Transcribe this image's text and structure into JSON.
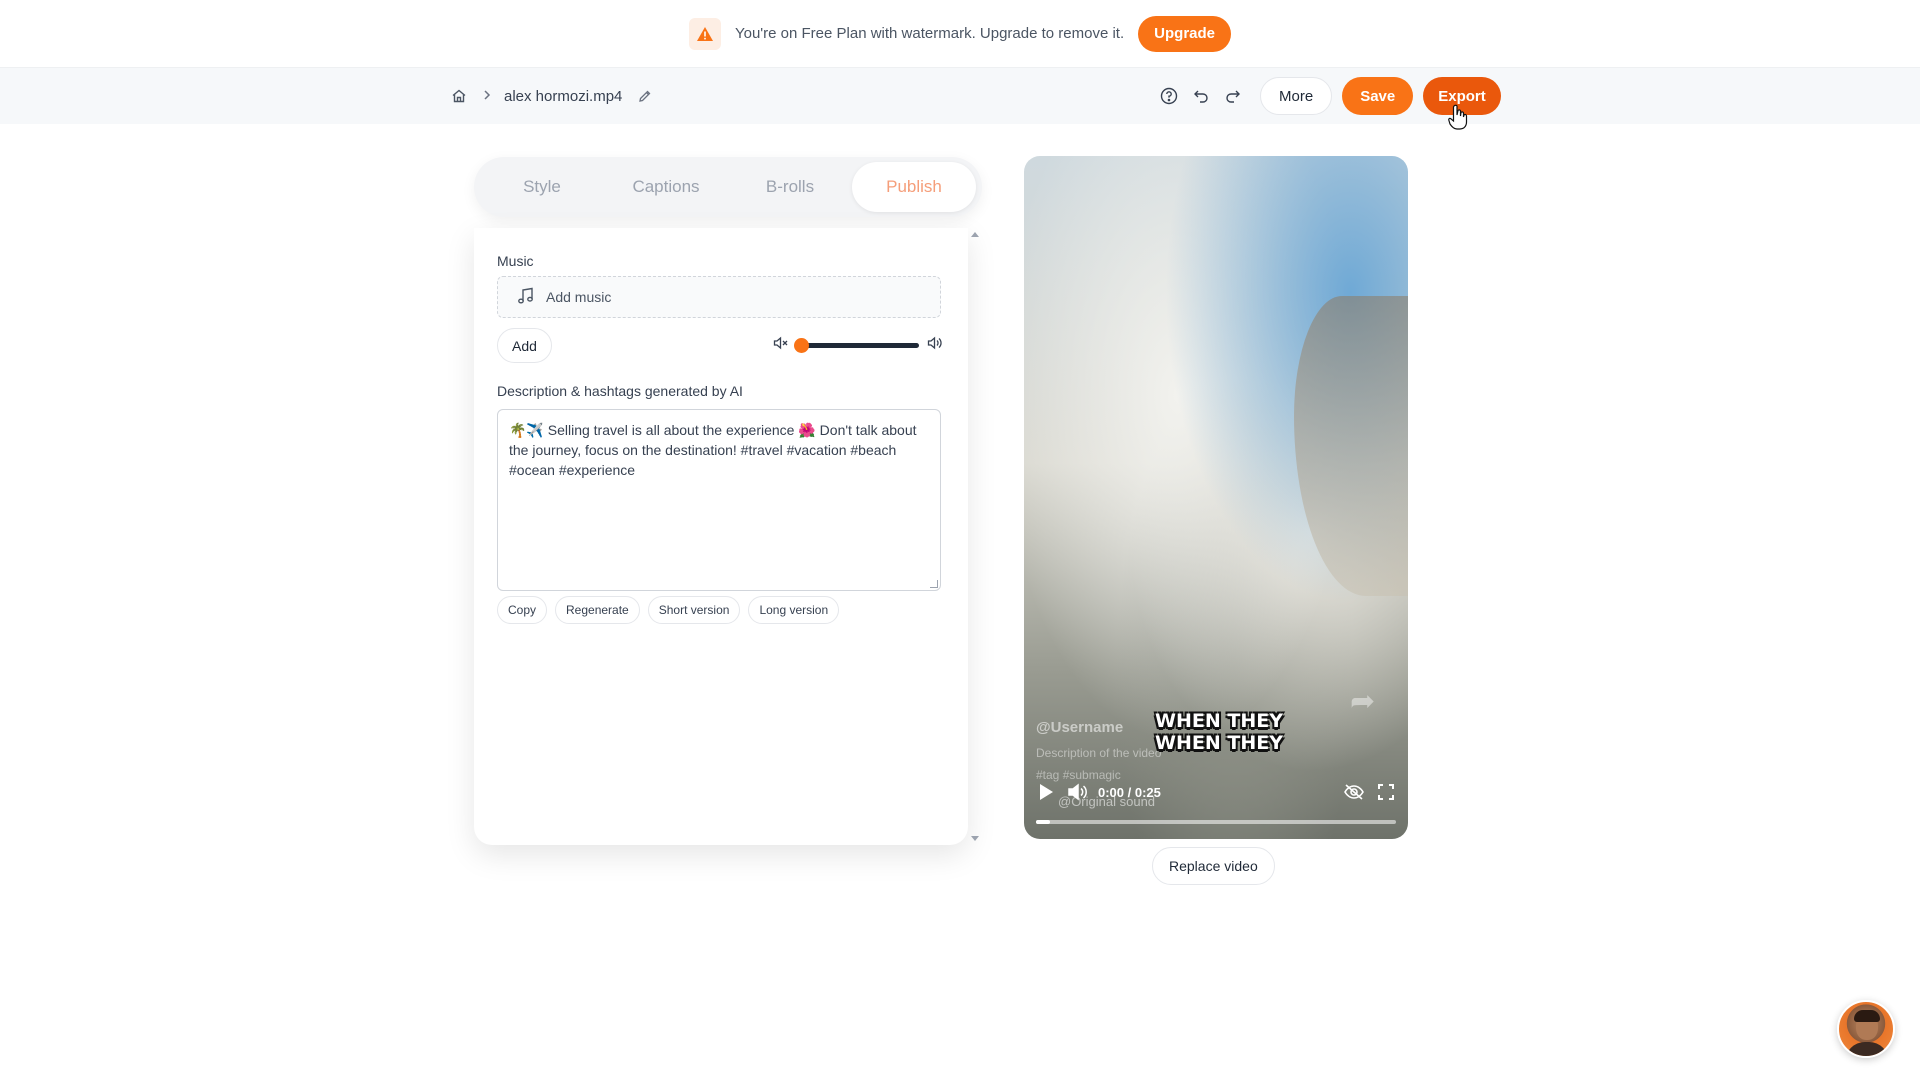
{
  "banner": {
    "text": "You're on Free Plan with watermark. Upgrade to remove it.",
    "upgrade_label": "Upgrade"
  },
  "toolbar": {
    "filename": "alex hormozi.mp4",
    "more_label": "More",
    "save_label": "Save",
    "export_label": "Export"
  },
  "tabs": [
    {
      "label": "Style"
    },
    {
      "label": "Captions"
    },
    {
      "label": "B-rolls"
    },
    {
      "label": "Publish"
    }
  ],
  "active_tab": "Publish",
  "music": {
    "label": "Music",
    "add_music_label": "Add music",
    "add_button": "Add",
    "volume_fraction": 0.03
  },
  "description": {
    "label": "Description & hashtags generated by AI",
    "text": "🌴✈️ Selling travel is all about the experience 🌺 Don't talk about the journey, focus on the destination! #travel #vacation #beach #ocean #experience",
    "actions": [
      "Copy",
      "Regenerate",
      "Short version",
      "Long version"
    ]
  },
  "video": {
    "username": "@Username",
    "overlay_description": "Description of the video",
    "overlay_tags": "#tag #submagic",
    "sound": "@Original sound",
    "caption_line1": "WHEN THEY",
    "caption_line2": "WHEN THEY",
    "time": "0:00 / 0:25",
    "progress_fraction": 0.04,
    "replace_label": "Replace video"
  },
  "colors": {
    "accent": "#f97316",
    "export": "#ea580c",
    "active_tab_text": "#f59e7a"
  }
}
